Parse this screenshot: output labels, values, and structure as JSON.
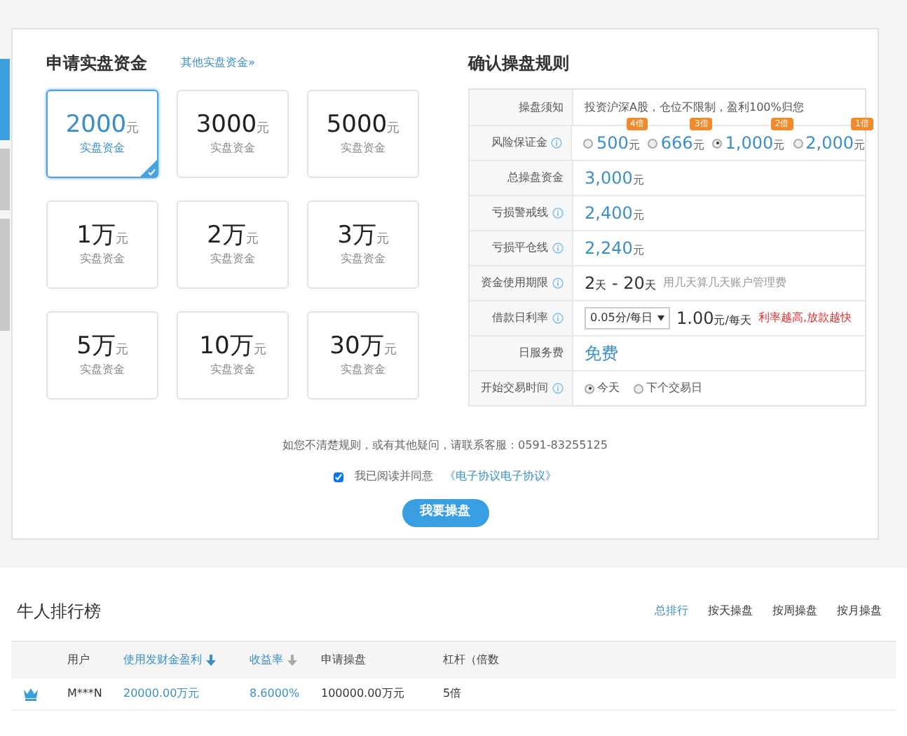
{
  "side_tabs": [
    {
      "selected": true
    },
    {
      "selected": false
    },
    {
      "selected": false
    }
  ],
  "apply": {
    "title": "申请实盘资金",
    "link": "其他实盘资金»",
    "options": [
      {
        "amount": "2000",
        "unit": "元",
        "caption": "实盘资金",
        "selected": true
      },
      {
        "amount": "3000",
        "unit": "元",
        "caption": "实盘资金",
        "selected": false
      },
      {
        "amount": "5000",
        "unit": "元",
        "caption": "实盘资金",
        "selected": false
      },
      {
        "amount": "1万",
        "unit": "元",
        "caption": "实盘资金",
        "selected": false
      },
      {
        "amount": "2万",
        "unit": "元",
        "caption": "实盘资金",
        "selected": false
      },
      {
        "amount": "3万",
        "unit": "元",
        "caption": "实盘资金",
        "selected": false
      },
      {
        "amount": "5万",
        "unit": "元",
        "caption": "实盘资金",
        "selected": false
      },
      {
        "amount": "10万",
        "unit": "元",
        "caption": "实盘资金",
        "selected": false
      },
      {
        "amount": "30万",
        "unit": "元",
        "caption": "实盘资金",
        "selected": false
      }
    ]
  },
  "rules": {
    "title": "确认操盘规则",
    "rows": [
      {
        "kind": "text",
        "label": "操盘须知",
        "info": false,
        "text": "投资沪深A股，仓位不限制，盈利100%归您"
      },
      {
        "kind": "radios",
        "label": "风险保证金",
        "info": true,
        "options": [
          {
            "value": "500",
            "unit": "元",
            "badge": "4倍",
            "selected": false
          },
          {
            "value": "666",
            "unit": "元",
            "badge": "3倍",
            "selected": false
          },
          {
            "value": "1,000",
            "unit": "元",
            "badge": "2倍",
            "selected": true
          },
          {
            "value": "2,000",
            "unit": "元",
            "badge": "1倍",
            "selected": false
          }
        ]
      },
      {
        "kind": "amount",
        "label": "总操盘资金",
        "info": false,
        "value": "3,000",
        "unit": "元"
      },
      {
        "kind": "amount",
        "label": "亏损警戒线",
        "info": true,
        "value": "2,400",
        "unit": "元"
      },
      {
        "kind": "amount",
        "label": "亏损平仓线",
        "info": true,
        "value": "2,240",
        "unit": "元"
      },
      {
        "kind": "range",
        "label": "资金使用期限",
        "info": true,
        "from": "2",
        "from_unit": "天",
        "sep": " - ",
        "to": "20",
        "to_unit": "天",
        "note": "用几天算几天账户管理费"
      },
      {
        "kind": "rate",
        "label": "借款日利率",
        "info": true,
        "select": "0.05分/每日",
        "value": "1.00",
        "unit": "元/每天",
        "note": "利率越高,放款越快"
      },
      {
        "kind": "free",
        "label": "日服务费",
        "info": false,
        "value": "免费"
      },
      {
        "kind": "choice",
        "label": "开始交易时间",
        "info": true,
        "options": [
          {
            "label": "今天",
            "selected": true
          },
          {
            "label": "下个交易日",
            "selected": false
          }
        ]
      }
    ]
  },
  "contact": "如您不清楚规则，或有其他疑问，请联系客服：0591-83255125",
  "agree": {
    "checked": true,
    "text": "我已阅读并同意",
    "link": "《电子协议电子协议》"
  },
  "submit": "我要操盘",
  "ranking": {
    "title": "牛人排行榜",
    "tabs": [
      {
        "label": "总排行",
        "selected": true
      },
      {
        "label": "按天操盘",
        "selected": false
      },
      {
        "label": "按周操盘",
        "selected": false
      },
      {
        "label": "按月操盘",
        "selected": false
      }
    ],
    "columns": [
      {
        "label": "用户",
        "highlight": false,
        "sort_arrow": false
      },
      {
        "label": "使用发财金盈利",
        "highlight": true,
        "sort_arrow": true,
        "sorted": true
      },
      {
        "label": "收益率",
        "highlight": true,
        "sort_arrow": true,
        "sorted": false
      },
      {
        "label": "申请操盘",
        "highlight": false,
        "sort_arrow": false
      },
      {
        "label": "杠杆（倍数",
        "highlight": false,
        "sort_arrow": false
      }
    ],
    "rows": [
      {
        "cells": [
          {
            "text": "M***N",
            "highlight": false
          },
          {
            "text": "20000.00万元",
            "highlight": true
          },
          {
            "text": "8.6000%",
            "highlight": true
          },
          {
            "text": "100000.00万元",
            "highlight": false
          },
          {
            "text": "5倍",
            "highlight": false
          }
        ]
      }
    ]
  }
}
